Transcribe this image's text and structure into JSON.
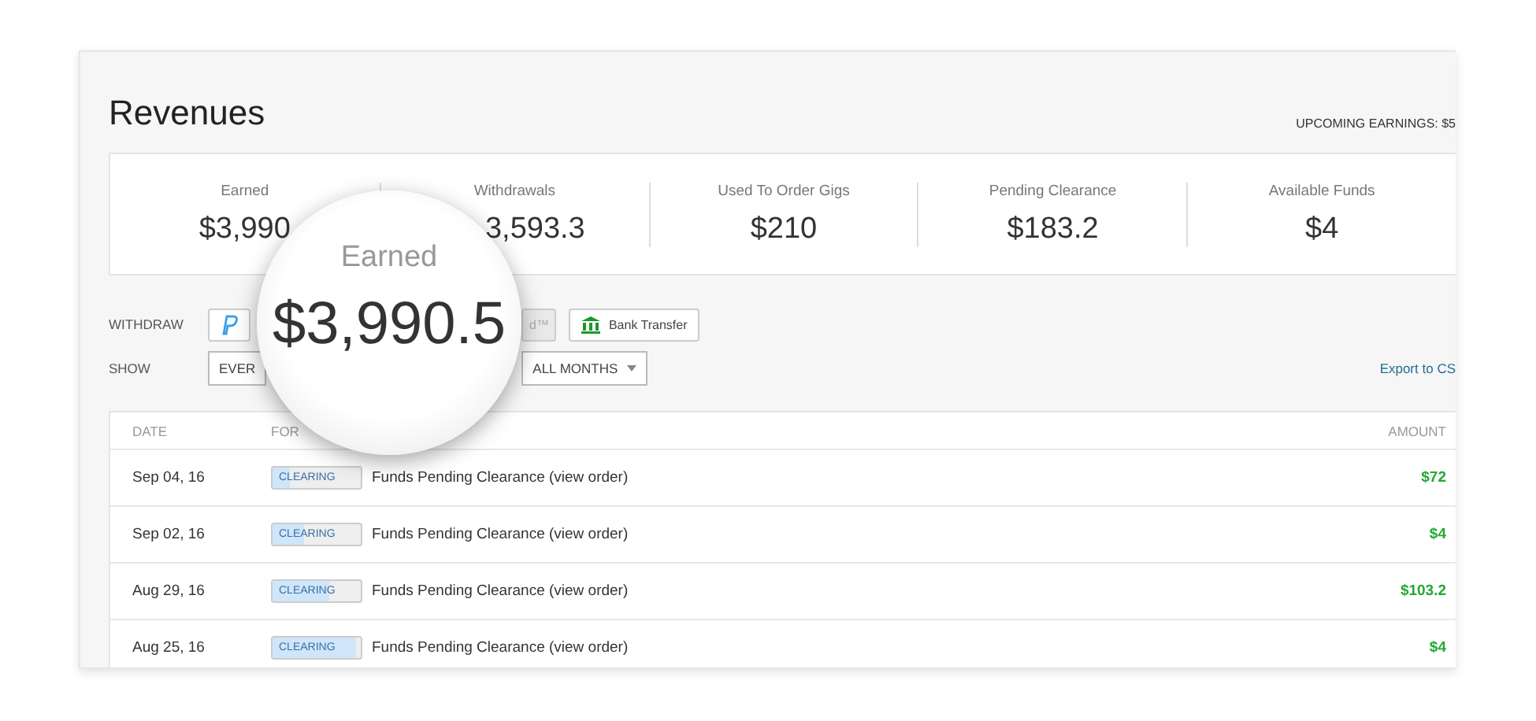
{
  "page": {
    "title": "Revenues",
    "upcoming": "UPCOMING EARNINGS: $5"
  },
  "stats": [
    {
      "label": "Earned",
      "value": "$3,990"
    },
    {
      "label": "Withdrawals",
      "value": "3,593.3"
    },
    {
      "label": "Used To Order Gigs",
      "value": "$210"
    },
    {
      "label": "Pending Clearance",
      "value": "$183.2"
    },
    {
      "label": "Available Funds",
      "value": "$4"
    }
  ],
  "withdraw": {
    "label": "WITHDRAW",
    "buttons": [
      {
        "kind": "paypal",
        "disabled": false
      },
      {
        "kind": "card",
        "label": "d™",
        "disabled": true
      },
      {
        "kind": "bank",
        "label": "Bank Transfer",
        "disabled": false
      }
    ]
  },
  "show": {
    "label": "SHOW",
    "filters": [
      {
        "value": "EVER"
      },
      {
        "value": "ALL MONTHS"
      }
    ],
    "export": "Export to CS"
  },
  "table": {
    "columns": [
      "DATE",
      "FOR",
      "AMOUNT"
    ],
    "rows": [
      {
        "date": "Sep 04, 16",
        "status": "CLEARING",
        "level": 0.2,
        "description": "Funds Pending Clearance (view order)",
        "amount": "$72"
      },
      {
        "date": "Sep 02, 16",
        "status": "CLEARING",
        "level": 0.35,
        "description": "Funds Pending Clearance (view order)",
        "amount": "$4"
      },
      {
        "date": "Aug 29, 16",
        "status": "CLEARING",
        "level": 0.65,
        "description": "Funds Pending Clearance (view order)",
        "amount": "$103.2"
      },
      {
        "date": "Aug 25, 16",
        "status": "CLEARING",
        "level": 0.95,
        "description": "Funds Pending Clearance (view order)",
        "amount": "$4"
      }
    ]
  },
  "magnifier": {
    "label": "Earned",
    "value": "$3,990.5"
  }
}
